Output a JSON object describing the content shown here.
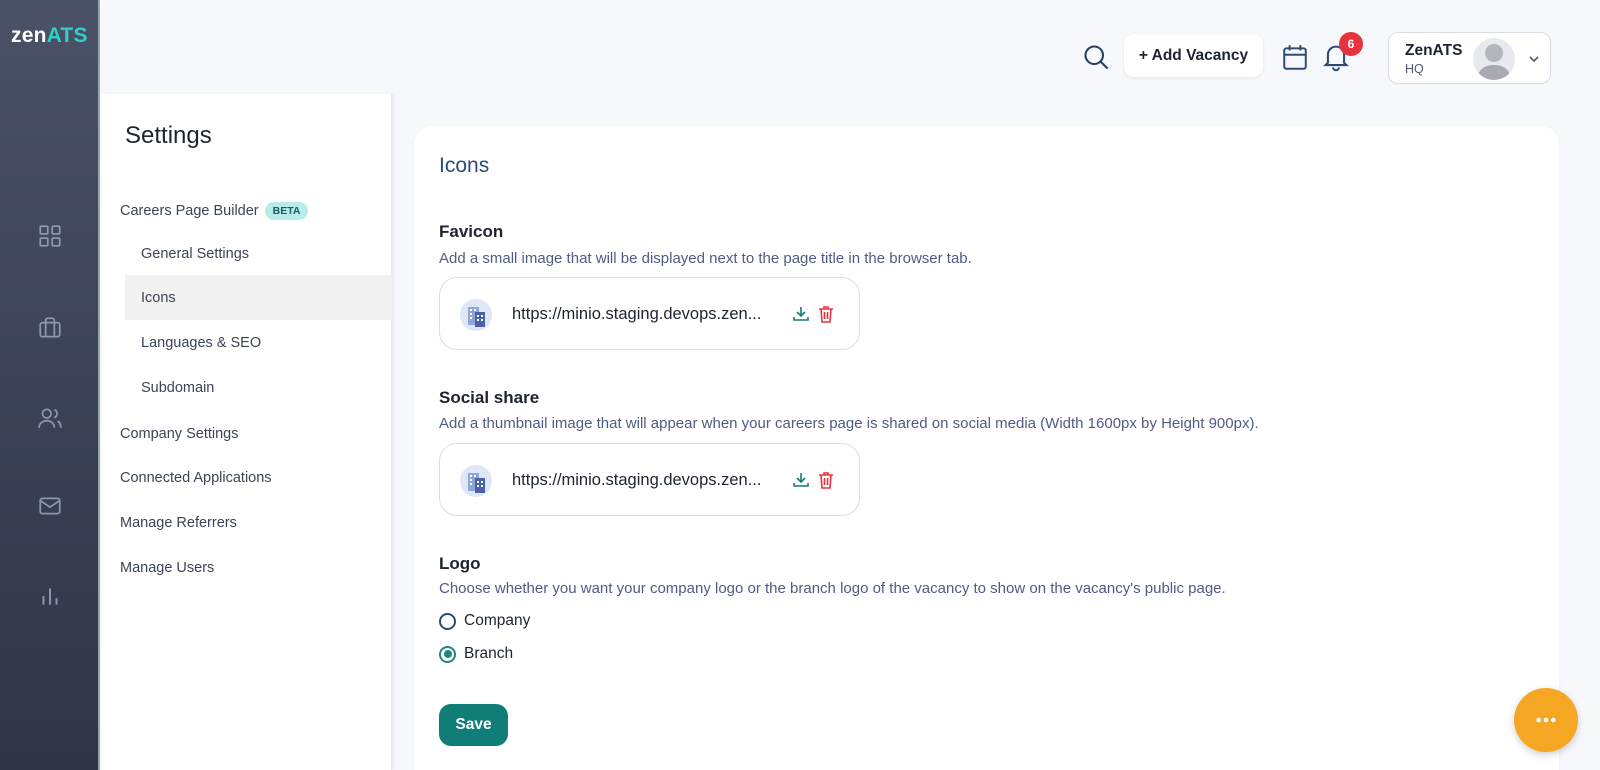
{
  "brand": {
    "logo_prefix": "zen",
    "logo_suffix": "ATS"
  },
  "rail": {
    "items": [
      {
        "icon": "dashboard-icon"
      },
      {
        "icon": "briefcase-icon"
      },
      {
        "icon": "users-icon"
      },
      {
        "icon": "mail-icon"
      },
      {
        "icon": "bar-chart-icon"
      }
    ]
  },
  "header": {
    "add_vacancy_label": "+ Add Vacancy",
    "notification_count": "6",
    "account": {
      "name": "ZenATS",
      "branch": "HQ"
    }
  },
  "sidebar": {
    "title": "Settings",
    "careers_page_builder": "Careers Page Builder",
    "beta_badge": "BETA",
    "sub_items": [
      {
        "label": "General Settings"
      },
      {
        "label": "Icons",
        "active": true
      },
      {
        "label": "Languages & SEO"
      },
      {
        "label": "Subdomain"
      }
    ],
    "items": [
      {
        "label": "Company Settings"
      },
      {
        "label": "Connected Applications"
      },
      {
        "label": "Manage Referrers"
      },
      {
        "label": "Manage Users"
      }
    ]
  },
  "main": {
    "title": "Icons",
    "favicon": {
      "title": "Favicon",
      "description": "Add a small image that will be displayed next to the page title in the browser tab.",
      "url": "https://minio.staging.devops.zen..."
    },
    "social_share": {
      "title": "Social share",
      "description": "Add a thumbnail image that will appear when your careers page is shared on social media (Width 1600px by Height 900px).",
      "url": "https://minio.staging.devops.zen..."
    },
    "logo": {
      "title": "Logo",
      "description": "Choose whether you want your company logo or the branch logo of the vacancy to show on the vacancy's public page.",
      "options": [
        {
          "label": "Company",
          "checked": false
        },
        {
          "label": "Branch",
          "checked": true
        }
      ]
    },
    "save_label": "Save"
  },
  "colors": {
    "accent": "#117d77",
    "title_blue": "#2c4a77",
    "badge_red": "#e5343f",
    "fab_orange": "#f5a623"
  }
}
